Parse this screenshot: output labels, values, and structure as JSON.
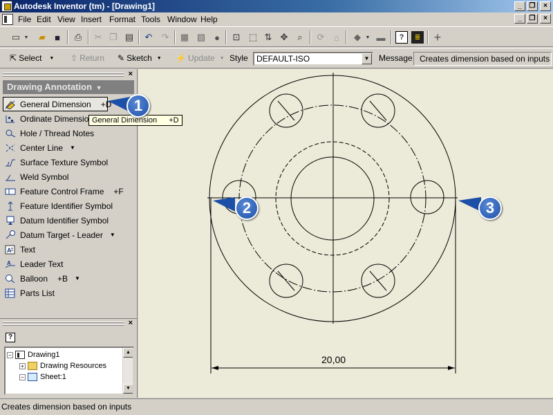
{
  "window": {
    "title": "Autodesk Inventor (tm) - [Drawing1]",
    "controls": [
      "_",
      "❐",
      "×"
    ]
  },
  "menubar": {
    "items": [
      "File",
      "Edit",
      "View",
      "Insert",
      "Format",
      "Tools",
      "Window",
      "Help"
    ],
    "doc_controls": [
      "_",
      "❐",
      "×"
    ]
  },
  "toolbar2": {
    "select_label": "Select",
    "return_label": "Return",
    "sketch_label": "Sketch",
    "update_label": "Update",
    "style_label": "Style",
    "style_value": "DEFAULT-ISO",
    "message_label": "Message",
    "message_value": "Creates dimension based on inputs"
  },
  "panel": {
    "header": "Drawing Annotation",
    "tools": [
      {
        "label": "General Dimension",
        "shortcut": "+D",
        "icon": "general-dimension-icon"
      },
      {
        "label": "Ordinate Dimension",
        "shortcut": "",
        "icon": "ordinate-dimension-icon"
      },
      {
        "label": "Hole / Thread Notes",
        "shortcut": "",
        "icon": "hole-thread-notes-icon"
      },
      {
        "label": "Center Line",
        "shortcut": "",
        "icon": "center-line-icon"
      },
      {
        "label": "Surface Texture Symbol",
        "shortcut": "",
        "icon": "surface-texture-icon"
      },
      {
        "label": "Weld Symbol",
        "shortcut": "",
        "icon": "weld-symbol-icon"
      },
      {
        "label": "Feature Control Frame",
        "shortcut": "+F",
        "icon": "feature-control-frame-icon"
      },
      {
        "label": "Feature Identifier Symbol",
        "shortcut": "",
        "icon": "feature-identifier-icon"
      },
      {
        "label": "Datum Identifier Symbol",
        "shortcut": "",
        "icon": "datum-identifier-icon"
      },
      {
        "label": "Datum Target - Leader",
        "shortcut": "",
        "icon": "datum-target-icon"
      },
      {
        "label": "Text",
        "shortcut": "",
        "icon": "text-icon"
      },
      {
        "label": "Leader Text",
        "shortcut": "",
        "icon": "leader-text-icon"
      },
      {
        "label": "Balloon",
        "shortcut": "+B",
        "icon": "balloon-icon"
      },
      {
        "label": "Parts List",
        "shortcut": "",
        "icon": "parts-list-icon"
      }
    ]
  },
  "tooltip": {
    "label": "General Dimension",
    "shortcut": "+D"
  },
  "browser": {
    "help": "?",
    "tree": [
      {
        "label": "Drawing1"
      },
      {
        "label": "Drawing Resources"
      },
      {
        "label": "Sheet:1"
      }
    ]
  },
  "drawing": {
    "dimension_text": "20,00"
  },
  "callouts": [
    "1",
    "2",
    "3"
  ],
  "statusbar": {
    "text": "Creates dimension based on inputs"
  },
  "colors": {
    "title_start": "#0a246a",
    "callout_blue": "#1c4fa8",
    "canvas_bg": "#ecead8"
  }
}
